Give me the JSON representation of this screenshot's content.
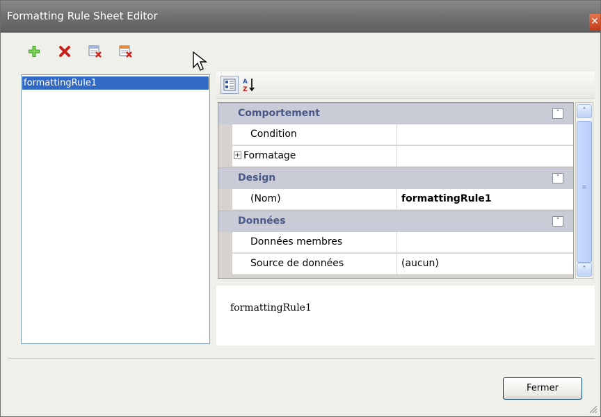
{
  "window": {
    "title": "Formatting Rule Sheet Editor",
    "close_glyph": "✕"
  },
  "toolbar": {
    "buttons": [
      {
        "name": "add-icon"
      },
      {
        "name": "delete-icon"
      },
      {
        "name": "remove-rule-icon"
      },
      {
        "name": "clear-rules-icon"
      }
    ]
  },
  "list": {
    "items": [
      {
        "label": "formattingRule1",
        "selected": true
      }
    ]
  },
  "property_grid": {
    "categories": [
      {
        "label": "Comportement",
        "collapse_glyph": "˄",
        "properties": [
          {
            "name": "Condition",
            "value": ""
          },
          {
            "name": "Formatage",
            "value": "",
            "expandable": true,
            "expander": "+"
          }
        ]
      },
      {
        "label": "Design",
        "collapse_glyph": "˄",
        "properties": [
          {
            "name": "(Nom)",
            "value": "formattingRule1",
            "bold": true
          }
        ]
      },
      {
        "label": "Données",
        "collapse_glyph": "˄",
        "properties": [
          {
            "name": "Données membres",
            "value": ""
          },
          {
            "name": "Source de données",
            "value": "(aucun)"
          }
        ]
      }
    ],
    "description": "formattingRule1",
    "scrollbar": {
      "up": "˄",
      "down": "˅",
      "grip": "≡"
    }
  },
  "footer": {
    "close_label": "Fermer"
  },
  "colors": {
    "selection": "#316ac5",
    "category_text": "#4a5888",
    "title_bar": "#6f6f6f"
  }
}
